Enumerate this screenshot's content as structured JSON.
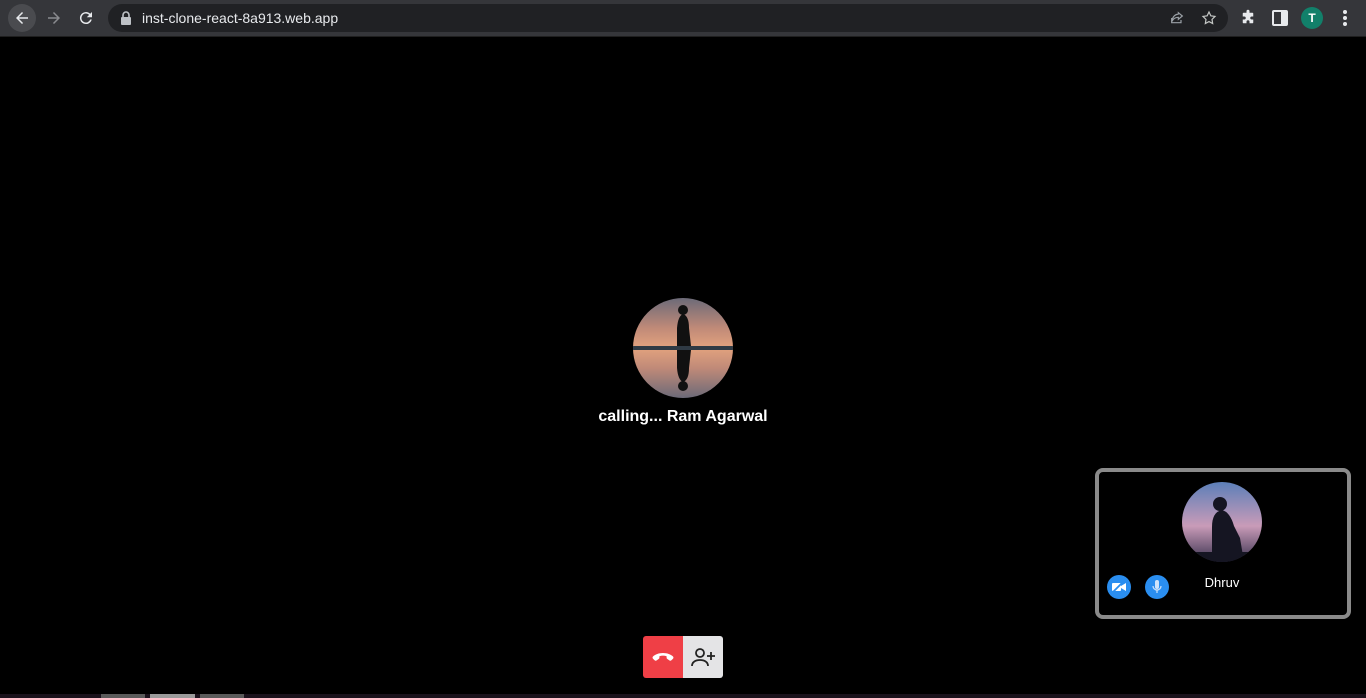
{
  "browser": {
    "url": "inst-clone-react-8a913.web.app",
    "profile_initial": "T"
  },
  "call": {
    "status_text": "calling... Ram Agarwal",
    "self_name": "Dhruv"
  },
  "colors": {
    "end_call": "#ef3f46",
    "mini_button": "#2a8ef0",
    "profile": "#12806a"
  },
  "icons": {
    "back": "arrow-left-icon",
    "forward": "arrow-right-icon",
    "reload": "reload-icon",
    "lock": "lock-icon",
    "share": "share-icon",
    "bookmark": "star-icon",
    "extensions": "puzzle-icon",
    "side_panel": "side-panel-icon",
    "menu": "kebab-menu-icon",
    "camera_off": "camera-off-icon",
    "microphone": "microphone-icon",
    "end_call": "phone-hangup-icon",
    "add_user": "add-user-icon"
  }
}
